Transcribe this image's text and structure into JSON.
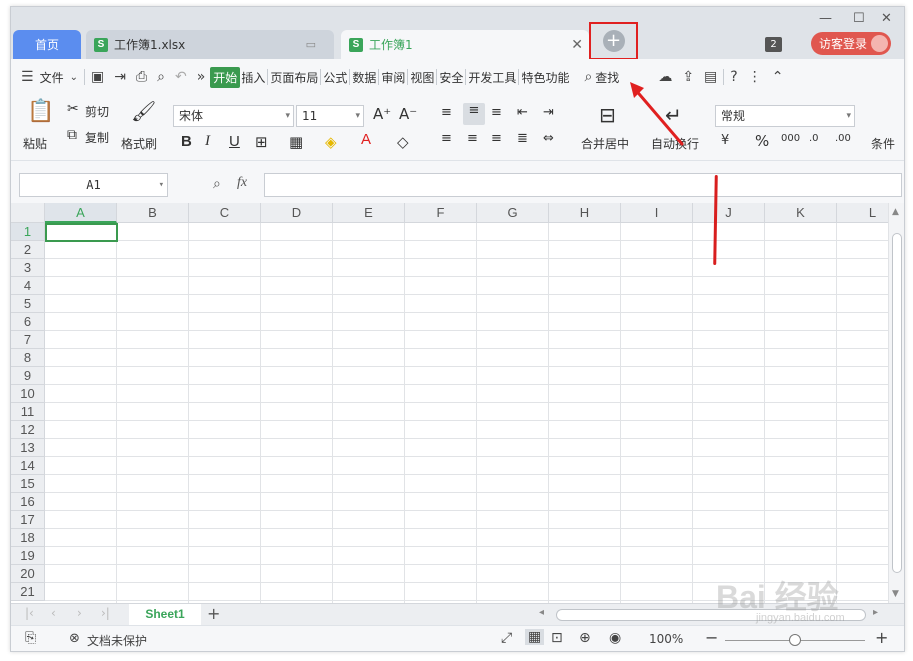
{
  "tabs": {
    "home": "首页",
    "file1": "工作簿1.xlsx",
    "active": "工作簿1",
    "new_tab_glyph": "+"
  },
  "titlebar": {
    "badge_count": "2",
    "login": "访客登录",
    "minimize": "—",
    "restore": "☐",
    "close": "✕"
  },
  "menubar": {
    "file": "文件",
    "items": [
      "开始",
      "插入",
      "页面布局",
      "公式",
      "数据",
      "审阅",
      "视图",
      "安全",
      "开发工具",
      "特色功能"
    ],
    "active_item": "开始",
    "search": "查找",
    "help": "?"
  },
  "ribbon": {
    "paste": "粘贴",
    "cut": "剪切",
    "copy": "复制",
    "format_painter": "格式刷",
    "font_name": "宋体",
    "font_size": "11",
    "bold": "B",
    "italic": "I",
    "underline": "U",
    "merge_center": "合并居中",
    "wrap_text": "自动换行",
    "number_format": "常规",
    "percent": "%",
    "thousands": "000",
    "conditional": "条件"
  },
  "formula_bar": {
    "name_box": "A1",
    "fx_label": "fx",
    "formula": ""
  },
  "grid": {
    "columns": [
      "A",
      "B",
      "C",
      "D",
      "E",
      "F",
      "G",
      "H",
      "I",
      "J",
      "K",
      "L"
    ],
    "rows": [
      "1",
      "2",
      "3",
      "4",
      "5",
      "6",
      "7",
      "8",
      "9",
      "10",
      "11",
      "12",
      "13",
      "14",
      "15",
      "16",
      "17",
      "18",
      "19",
      "20",
      "21"
    ],
    "active_cell": "A1"
  },
  "sheets": {
    "active": "Sheet1",
    "add": "+"
  },
  "statusbar": {
    "protect": "文档未保护",
    "zoom": "100%",
    "zoom_out": "−",
    "zoom_in": "+"
  },
  "watermark": {
    "brand": "Bai  经验",
    "url": "jingyan.baidu.com"
  },
  "colors": {
    "accent_green": "#3a9a4f",
    "home_tab_blue": "#5b8def",
    "login_red": "#e0574f",
    "annotation_red": "#e02020"
  }
}
